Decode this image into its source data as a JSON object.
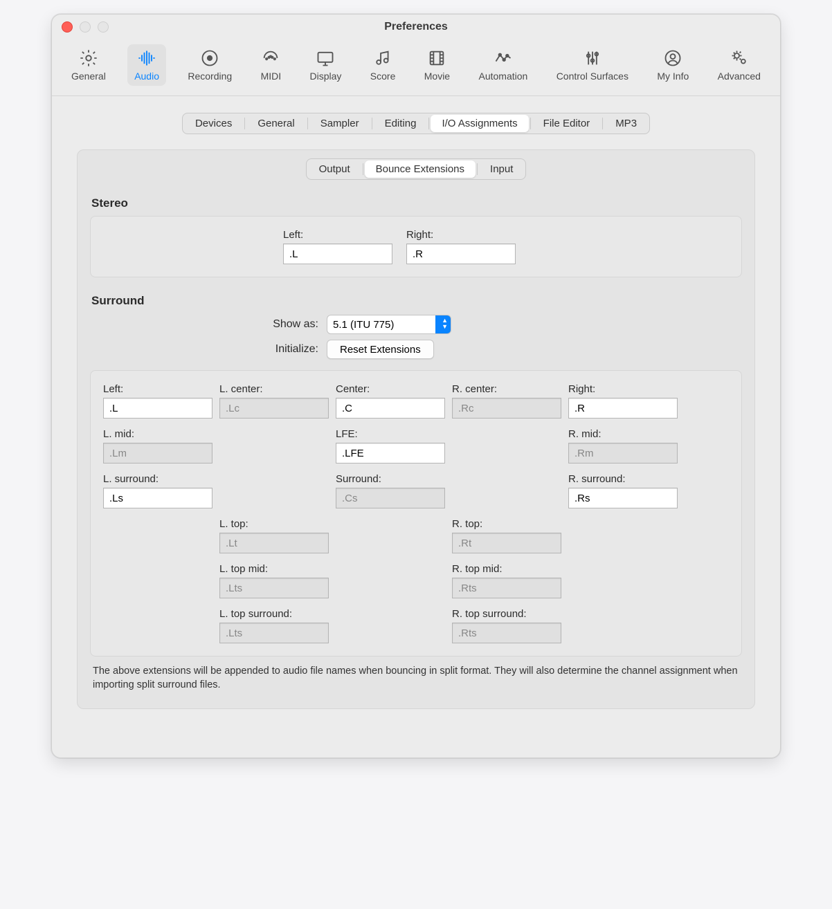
{
  "window": {
    "title": "Preferences"
  },
  "toolbar": {
    "items": [
      {
        "id": "general",
        "label": "General"
      },
      {
        "id": "audio",
        "label": "Audio"
      },
      {
        "id": "recording",
        "label": "Recording"
      },
      {
        "id": "midi",
        "label": "MIDI"
      },
      {
        "id": "display",
        "label": "Display"
      },
      {
        "id": "score",
        "label": "Score"
      },
      {
        "id": "movie",
        "label": "Movie"
      },
      {
        "id": "automation",
        "label": "Automation"
      },
      {
        "id": "control-surfaces",
        "label": "Control Surfaces"
      },
      {
        "id": "my-info",
        "label": "My Info"
      },
      {
        "id": "advanced",
        "label": "Advanced"
      }
    ],
    "active": "audio"
  },
  "tabs1": {
    "items": [
      "Devices",
      "General",
      "Sampler",
      "Editing",
      "I/O Assignments",
      "File Editor",
      "MP3"
    ],
    "active": "I/O Assignments"
  },
  "tabs2": {
    "items": [
      "Output",
      "Bounce Extensions",
      "Input"
    ],
    "active": "Bounce Extensions"
  },
  "sections": {
    "stereo_title": "Stereo",
    "surround_title": "Surround"
  },
  "stereo": {
    "left_label": "Left:",
    "left_value": ".L",
    "right_label": "Right:",
    "right_value": ".R"
  },
  "surround": {
    "show_as_label": "Show as:",
    "show_as_value": "5.1 (ITU 775)",
    "initialize_label": "Initialize:",
    "reset_button": "Reset Extensions",
    "fields": {
      "left": {
        "label": "Left:",
        "value": ".L",
        "enabled": true
      },
      "lcenter": {
        "label": "L. center:",
        "value": ".Lc",
        "enabled": false
      },
      "center": {
        "label": "Center:",
        "value": ".C",
        "enabled": true
      },
      "rcenter": {
        "label": "R. center:",
        "value": ".Rc",
        "enabled": false
      },
      "right": {
        "label": "Right:",
        "value": ".R",
        "enabled": true
      },
      "lmid": {
        "label": "L. mid:",
        "value": ".Lm",
        "enabled": false
      },
      "lfe": {
        "label": "LFE:",
        "value": ".LFE",
        "enabled": true
      },
      "rmid": {
        "label": "R. mid:",
        "value": ".Rm",
        "enabled": false
      },
      "lsurround": {
        "label": "L. surround:",
        "value": ".Ls",
        "enabled": true
      },
      "surround": {
        "label": "Surround:",
        "value": ".Cs",
        "enabled": false
      },
      "rsurround": {
        "label": "R. surround:",
        "value": ".Rs",
        "enabled": true
      },
      "ltop": {
        "label": "L. top:",
        "value": ".Lt",
        "enabled": false
      },
      "rtop": {
        "label": "R. top:",
        "value": ".Rt",
        "enabled": false
      },
      "ltopmid": {
        "label": "L. top mid:",
        "value": ".Lts",
        "enabled": false
      },
      "rtopmid": {
        "label": "R. top mid:",
        "value": ".Rts",
        "enabled": false
      },
      "ltopsurround": {
        "label": "L. top surround:",
        "value": ".Lts",
        "enabled": false
      },
      "rtopsurround": {
        "label": "R. top surround:",
        "value": ".Rts",
        "enabled": false
      }
    }
  },
  "note": "The above extensions will be appended to audio file names when bouncing in split format. They will also determine the channel assignment when importing split surround files."
}
